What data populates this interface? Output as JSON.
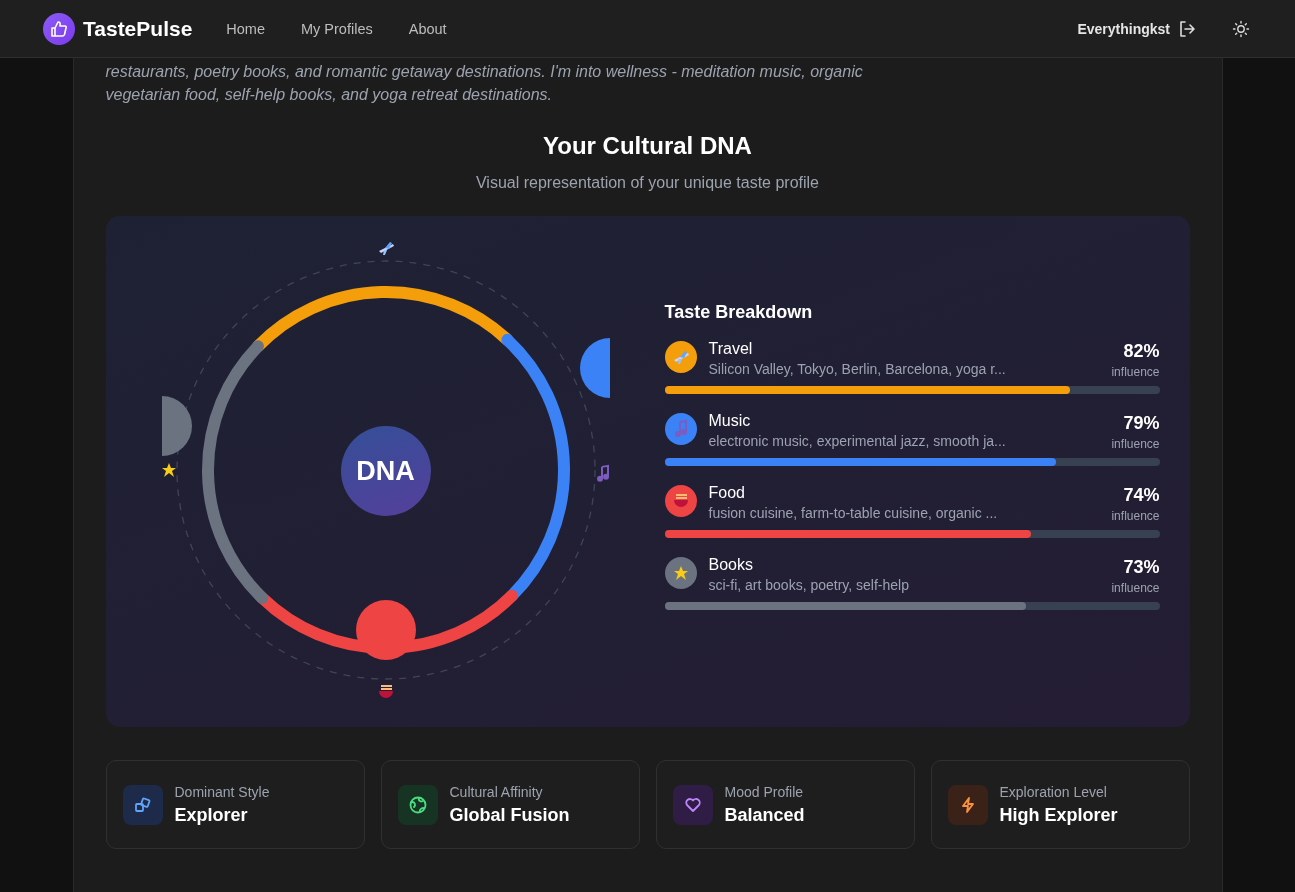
{
  "header": {
    "brand": "TastePulse",
    "nav": [
      {
        "label": "Home"
      },
      {
        "label": "My Profiles"
      },
      {
        "label": "About"
      }
    ],
    "user": "Everythingkst"
  },
  "intro": {
    "text": "restaurants, poetry books, and romantic getaway destinations. I'm into wellness - meditation music, organic vegetarian food, self-help books, and yoga retreat destinations."
  },
  "dna": {
    "title": "Your Cultural DNA",
    "subtitle": "Visual representation of your unique taste profile",
    "center_label": "DNA",
    "breakdown_title": "Taste Breakdown",
    "categories": [
      {
        "kind": "travel",
        "name": "Travel",
        "items": "Silicon Valley, Tokyo, Berlin, Barcelona, yoga r...",
        "percent": "82%",
        "note": "influence",
        "level": 0.82,
        "color": "#f59e0b"
      },
      {
        "kind": "music",
        "name": "Music",
        "items": "electronic music, experimental jazz, smooth ja...",
        "percent": "79%",
        "note": "influence",
        "level": 0.79,
        "color": "#3b82f6"
      },
      {
        "kind": "food",
        "name": "Food",
        "items": "fusion cuisine, farm-to-table cuisine, organic ...",
        "percent": "74%",
        "note": "influence",
        "level": 0.74,
        "color": "#ef4444"
      },
      {
        "kind": "books",
        "name": "Books",
        "items": "sci-fi, art books, poetry, self-help",
        "percent": "73%",
        "note": "influence",
        "level": 0.73,
        "color": "#6b7280"
      }
    ]
  },
  "traits": [
    {
      "kind": "style",
      "label": "Dominant Style",
      "value": "Explorer"
    },
    {
      "kind": "affinity",
      "label": "Cultural Affinity",
      "value": "Global Fusion"
    },
    {
      "kind": "mood",
      "label": "Mood Profile",
      "value": "Balanced"
    },
    {
      "kind": "exploration",
      "label": "Exploration Level",
      "value": "High Explorer"
    }
  ]
}
